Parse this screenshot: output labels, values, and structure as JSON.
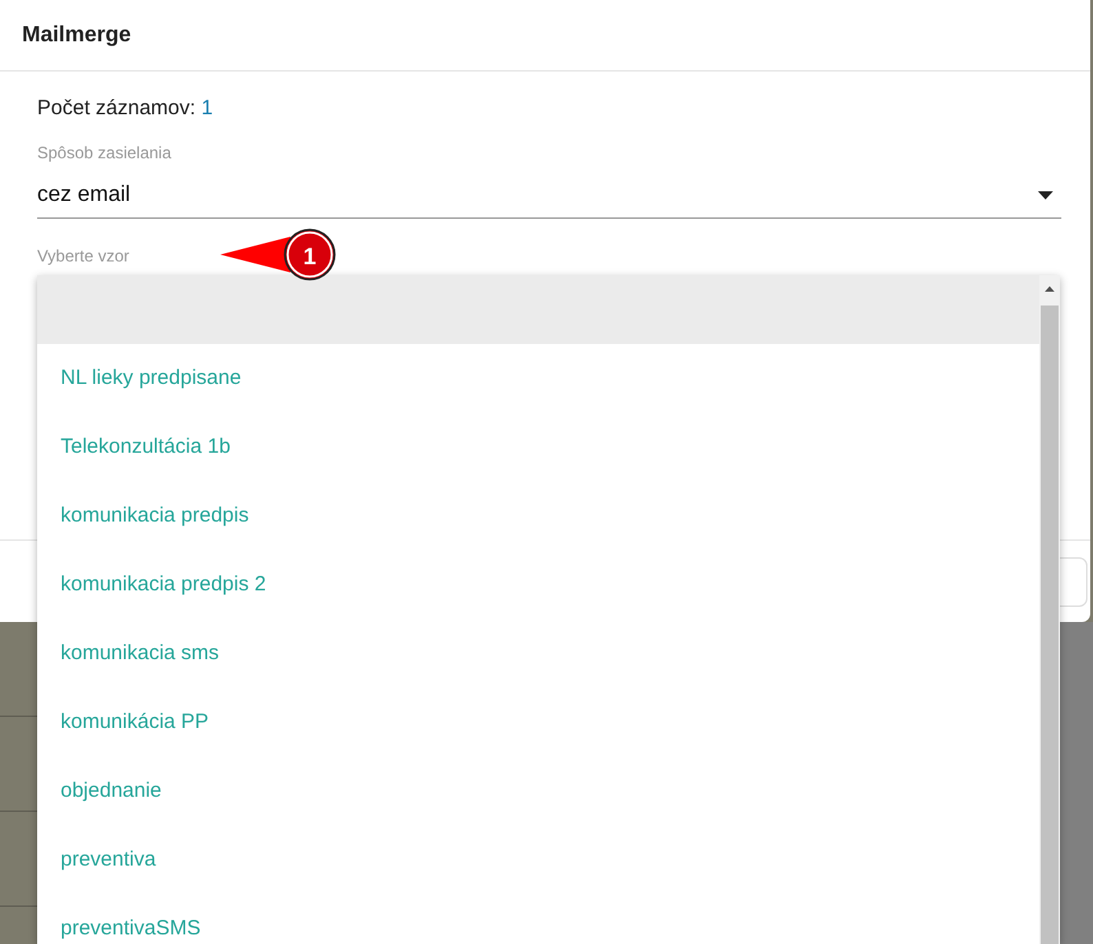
{
  "dialog": {
    "title": "Mailmerge"
  },
  "record_count": {
    "label": "Počet záznamov:",
    "value": "1"
  },
  "delivery_method": {
    "label": "Spôsob zasielania",
    "value": "cez email"
  },
  "template_select": {
    "label": "Vyberte vzor",
    "expanded": true
  },
  "annotation": {
    "number": "1"
  },
  "options": [
    {
      "highlighted": true
    },
    {
      "label": "NL lieky predpisane",
      "highlighted": false
    },
    {
      "label": "Telekonzultácia 1b",
      "highlighted": false
    },
    {
      "label": "komunikacia predpis",
      "highlighted": false
    },
    {
      "label": "komunikacia predpis 2",
      "highlighted": false
    },
    {
      "label": "komunikacia sms",
      "highlighted": false
    },
    {
      "label": "komunikácia PP",
      "highlighted": false
    },
    {
      "label": "objednanie",
      "highlighted": false
    },
    {
      "label": "preventiva",
      "highlighted": false
    },
    {
      "label": "preventivaSMS",
      "highlighted": false
    }
  ]
}
